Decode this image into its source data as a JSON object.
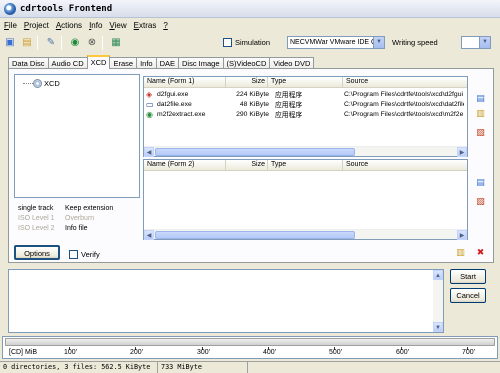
{
  "window": {
    "title": "cdrtools Frontend"
  },
  "menu": [
    {
      "mnemonic": "F",
      "rest": "ile"
    },
    {
      "mnemonic": "P",
      "rest": "roject"
    },
    {
      "mnemonic": "A",
      "rest": "ctions"
    },
    {
      "mnemonic": "I",
      "rest": "nfo"
    },
    {
      "mnemonic": "V",
      "rest": "iew"
    },
    {
      "mnemonic": "E",
      "rest": "xtras"
    },
    {
      "mnemonic": "?",
      "rest": ""
    }
  ],
  "toolbar": {
    "simulation_label": "Simulation",
    "drive": "NECVMWar VMware IDE CD",
    "writing_speed_label": "Writing speed",
    "writing_speed_value": ""
  },
  "tabs": [
    "Data Disc",
    "Audio CD",
    "XCD",
    "Erase",
    "Info",
    "DAE",
    "Disc Image",
    "(S)VideoCD",
    "Video DVD"
  ],
  "active_tab": "XCD",
  "tree": {
    "root": "XCD"
  },
  "info": {
    "r1k": "single track",
    "r1v": "Keep extension",
    "r2k": "ISO Level 1",
    "r2v": "Overburn",
    "r3k": "ISO Level 2",
    "r3v": "Info file"
  },
  "list1": {
    "headers": [
      "Name (Form 1)",
      "Size",
      "Type",
      "Source"
    ],
    "rows": [
      {
        "name": "d2fgui.exe",
        "size": "224 KiByte",
        "type": "应用程序",
        "source": "C:\\Program Files\\cdrtfe\\tools\\xcd\\d2fgui"
      },
      {
        "name": "dat2file.exe",
        "size": "48 KiByte",
        "type": "应用程序",
        "source": "C:\\Program Files\\cdrtfe\\tools\\xcd\\dat2file"
      },
      {
        "name": "m2f2extract.exe",
        "size": "290 KiByte",
        "type": "应用程序",
        "source": "C:\\Program Files\\cdrtfe\\tools\\xcd\\m2f2e"
      }
    ]
  },
  "list2": {
    "headers": [
      "Name (Form 2)",
      "Size",
      "Type",
      "Source"
    ]
  },
  "buttons": {
    "options": "Options",
    "verify": "Verify",
    "start": "Start",
    "cancel": "Cancel"
  },
  "ruler": {
    "unit": "[CD] MiB",
    "ticks": [
      "100'",
      "200'",
      "300'",
      "400'",
      "500'",
      "600'",
      "700'"
    ]
  },
  "status": {
    "summary": "0 directories, 3 files: 562.5 KiByte",
    "capacity": "733 MiByte"
  }
}
